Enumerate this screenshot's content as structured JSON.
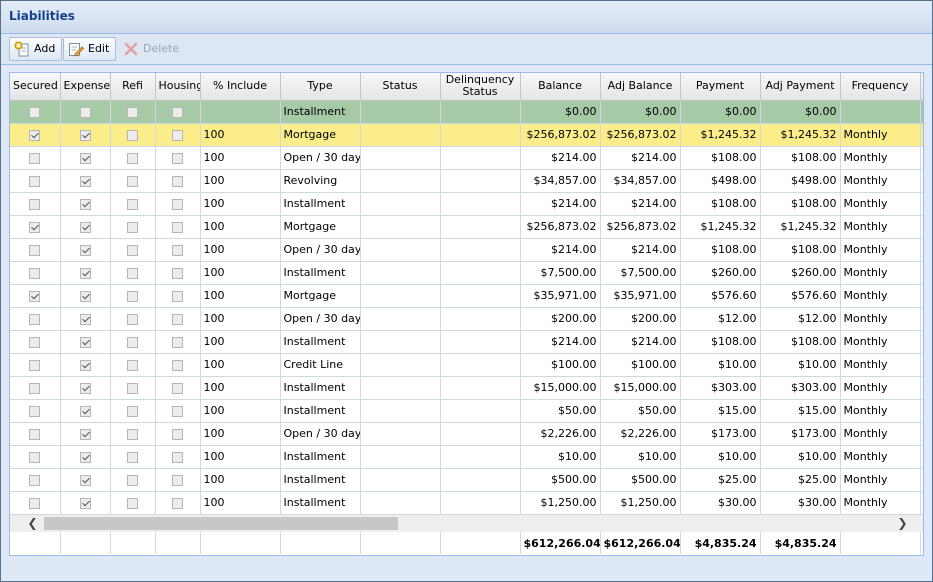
{
  "panel": {
    "title": "Liabilities"
  },
  "toolbar": {
    "add_label": "Add",
    "edit_label": "Edit",
    "delete_label": "Delete"
  },
  "grid": {
    "columns": [
      "Secured",
      "Expense",
      "Refi",
      "Housing",
      "% Include",
      "Type",
      "Status",
      "Delinquency Status",
      "Balance",
      "Adj Balance",
      "Payment",
      "Adj Payment",
      "Frequency"
    ],
    "summary_row": {
      "type": "Installment",
      "balance": "$0.00",
      "adj_balance": "$0.00",
      "payment": "$0.00",
      "adj_payment": "$0.00"
    },
    "rows": [
      {
        "secured": true,
        "expense": true,
        "include": "100",
        "type": "Mortgage",
        "balance": "$256,873.02",
        "adj_balance": "$256,873.02",
        "payment": "$1,245.32",
        "adj_payment": "$1,245.32",
        "frequency": "Monthly",
        "selected": true
      },
      {
        "secured": false,
        "expense": true,
        "include": "100",
        "type": "Open / 30 day",
        "balance": "$214.00",
        "adj_balance": "$214.00",
        "payment": "$108.00",
        "adj_payment": "$108.00",
        "frequency": "Monthly"
      },
      {
        "secured": false,
        "expense": true,
        "include": "100",
        "type": "Revolving",
        "balance": "$34,857.00",
        "adj_balance": "$34,857.00",
        "payment": "$498.00",
        "adj_payment": "$498.00",
        "frequency": "Monthly"
      },
      {
        "secured": false,
        "expense": true,
        "include": "100",
        "type": "Installment",
        "balance": "$214.00",
        "adj_balance": "$214.00",
        "payment": "$108.00",
        "adj_payment": "$108.00",
        "frequency": "Monthly"
      },
      {
        "secured": true,
        "expense": true,
        "include": "100",
        "type": "Mortgage",
        "balance": "$256,873.02",
        "adj_balance": "$256,873.02",
        "payment": "$1,245.32",
        "adj_payment": "$1,245.32",
        "frequency": "Monthly"
      },
      {
        "secured": false,
        "expense": true,
        "include": "100",
        "type": "Open / 30 day",
        "balance": "$214.00",
        "adj_balance": "$214.00",
        "payment": "$108.00",
        "adj_payment": "$108.00",
        "frequency": "Monthly"
      },
      {
        "secured": false,
        "expense": true,
        "include": "100",
        "type": "Installment",
        "balance": "$7,500.00",
        "adj_balance": "$7,500.00",
        "payment": "$260.00",
        "adj_payment": "$260.00",
        "frequency": "Monthly"
      },
      {
        "secured": true,
        "expense": true,
        "include": "100",
        "type": "Mortgage",
        "balance": "$35,971.00",
        "adj_balance": "$35,971.00",
        "payment": "$576.60",
        "adj_payment": "$576.60",
        "frequency": "Monthly"
      },
      {
        "secured": false,
        "expense": true,
        "include": "100",
        "type": "Open / 30 day",
        "balance": "$200.00",
        "adj_balance": "$200.00",
        "payment": "$12.00",
        "adj_payment": "$12.00",
        "frequency": "Monthly"
      },
      {
        "secured": false,
        "expense": true,
        "include": "100",
        "type": "Installment",
        "balance": "$214.00",
        "adj_balance": "$214.00",
        "payment": "$108.00",
        "adj_payment": "$108.00",
        "frequency": "Monthly"
      },
      {
        "secured": false,
        "expense": true,
        "include": "100",
        "type": "Credit Line",
        "balance": "$100.00",
        "adj_balance": "$100.00",
        "payment": "$10.00",
        "adj_payment": "$10.00",
        "frequency": "Monthly"
      },
      {
        "secured": false,
        "expense": true,
        "include": "100",
        "type": "Installment",
        "balance": "$15,000.00",
        "adj_balance": "$15,000.00",
        "payment": "$303.00",
        "adj_payment": "$303.00",
        "frequency": "Monthly"
      },
      {
        "secured": false,
        "expense": true,
        "include": "100",
        "type": "Installment",
        "balance": "$50.00",
        "adj_balance": "$50.00",
        "payment": "$15.00",
        "adj_payment": "$15.00",
        "frequency": "Monthly"
      },
      {
        "secured": false,
        "expense": true,
        "include": "100",
        "type": "Open / 30 day",
        "balance": "$2,226.00",
        "adj_balance": "$2,226.00",
        "payment": "$173.00",
        "adj_payment": "$173.00",
        "frequency": "Monthly"
      },
      {
        "secured": false,
        "expense": true,
        "include": "100",
        "type": "Installment",
        "balance": "$10.00",
        "adj_balance": "$10.00",
        "payment": "$10.00",
        "adj_payment": "$10.00",
        "frequency": "Monthly"
      },
      {
        "secured": false,
        "expense": true,
        "include": "100",
        "type": "Installment",
        "balance": "$500.00",
        "adj_balance": "$500.00",
        "payment": "$25.00",
        "adj_payment": "$25.00",
        "frequency": "Monthly"
      },
      {
        "secured": false,
        "expense": true,
        "include": "100",
        "type": "Installment",
        "balance": "$1,250.00",
        "adj_balance": "$1,250.00",
        "payment": "$30.00",
        "adj_payment": "$30.00",
        "frequency": "Monthly"
      }
    ],
    "totals": {
      "balance": "$612,266.04",
      "adj_balance": "$612,266.04",
      "payment": "$4,835.24",
      "adj_payment": "$4,835.24"
    }
  }
}
